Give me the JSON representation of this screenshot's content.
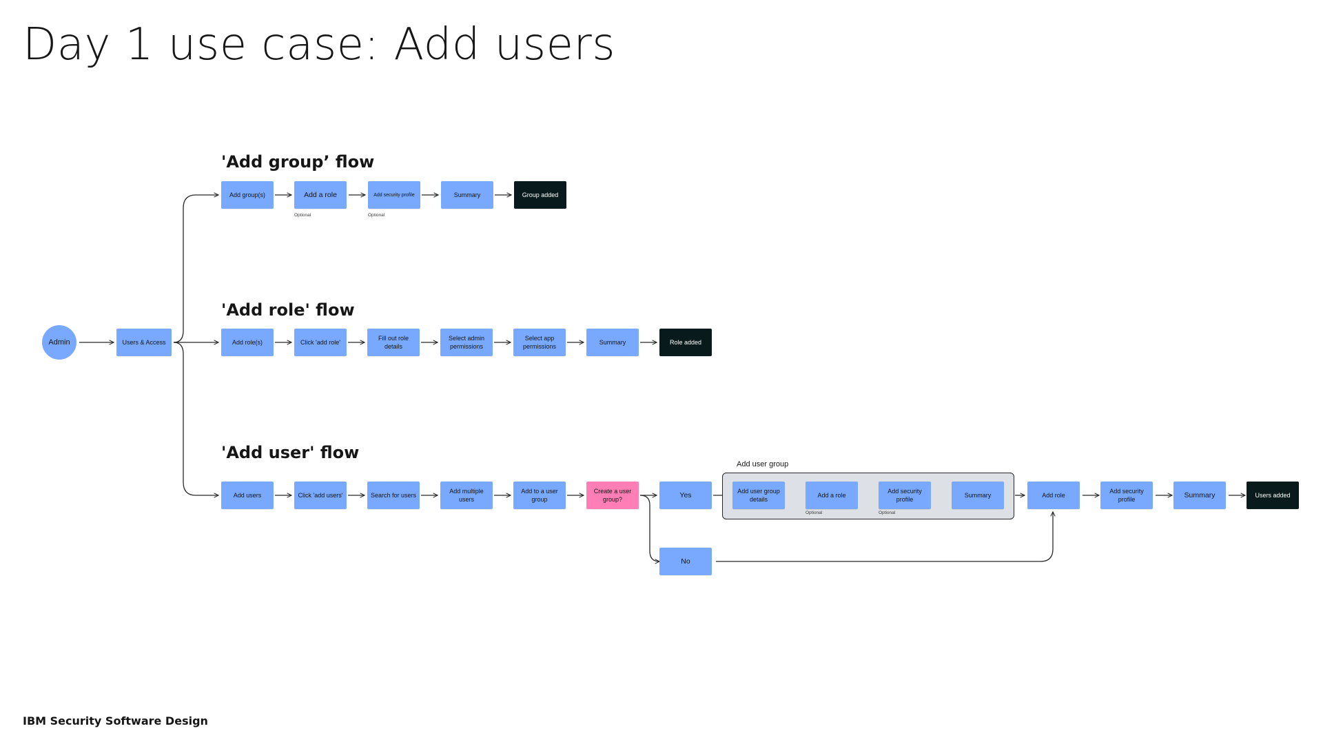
{
  "title": "Day 1 use case: Add users",
  "footer": "IBM Security Software Design",
  "colors": {
    "node": "#78a9ff",
    "terminal": "#081a1c",
    "decision": "#ff7eb6",
    "group_fill": "#dde1e6",
    "line": "#262626"
  },
  "start": {
    "admin": "Admin",
    "users_access": "Users & Access"
  },
  "group_flow": {
    "title": "'Add group’ flow",
    "steps": [
      "Add group(s)",
      "Add a role",
      "Add security profile",
      "Summary",
      "Group added"
    ],
    "optional_label": "Optional"
  },
  "role_flow": {
    "title": "'Add role' flow",
    "steps": [
      "Add role(s)",
      "Click 'add role'",
      "Fill out role details",
      "Select admin permissions",
      "Select app permissions",
      "Summary",
      "Role added"
    ]
  },
  "user_flow": {
    "title": "'Add user' flow",
    "steps": [
      "Add users",
      "Click 'add users'",
      "Search for users",
      "Add multiple users",
      "Add to a user group",
      "Create a user group?"
    ],
    "yes": "Yes",
    "no": "No",
    "user_group": {
      "label": "Add user group",
      "steps": [
        "Add user group details",
        "Add a role",
        "Add security profile",
        "Summary"
      ],
      "optional_label": "Optional"
    },
    "tail_steps": [
      "Add role",
      "Add security profile",
      "Summary",
      "Users added"
    ]
  }
}
